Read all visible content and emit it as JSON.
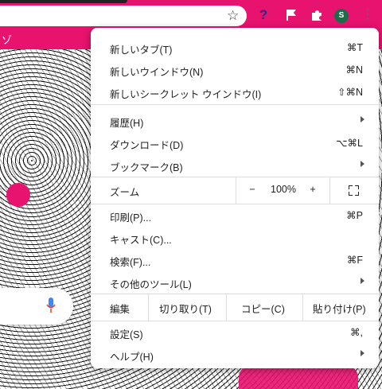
{
  "toolbar": {
    "avatar_letter": "S",
    "help_icon": "question-mark-icon",
    "bookmark_icon": "star-icon"
  },
  "menu": {
    "new_tab": {
      "label": "新しいタブ(T)",
      "shortcut": "⌘T"
    },
    "new_window": {
      "label": "新しいウインドウ(N)",
      "shortcut": "⌘N"
    },
    "incognito": {
      "label": "新しいシークレット ウインドウ(I)",
      "shortcut": "⇧⌘N"
    },
    "history": {
      "label": "履歴(H)"
    },
    "downloads": {
      "label": "ダウンロード(D)",
      "shortcut": "⌥⌘L"
    },
    "bookmarks": {
      "label": "ブックマーク(B)"
    },
    "zoom": {
      "label": "ズーム",
      "minus": "−",
      "value": "100%",
      "plus": "+"
    },
    "print": {
      "label": "印刷(P)...",
      "shortcut": "⌘P"
    },
    "cast": {
      "label": "キャスト(C)..."
    },
    "find": {
      "label": "検索(F)...",
      "shortcut": "⌘F"
    },
    "more_tools": {
      "label": "その他のツール(L)"
    },
    "edit": {
      "label": "編集",
      "cut": "切り取り(T)",
      "copy": "コピー(C)",
      "paste": "貼り付け(P)"
    },
    "settings": {
      "label": "設定(S)",
      "shortcut": "⌘,"
    },
    "help": {
      "label": "ヘルプ(H)"
    }
  },
  "colors": {
    "brand_pink": "#e8126f",
    "avatar_green": "#1e6b4a"
  }
}
